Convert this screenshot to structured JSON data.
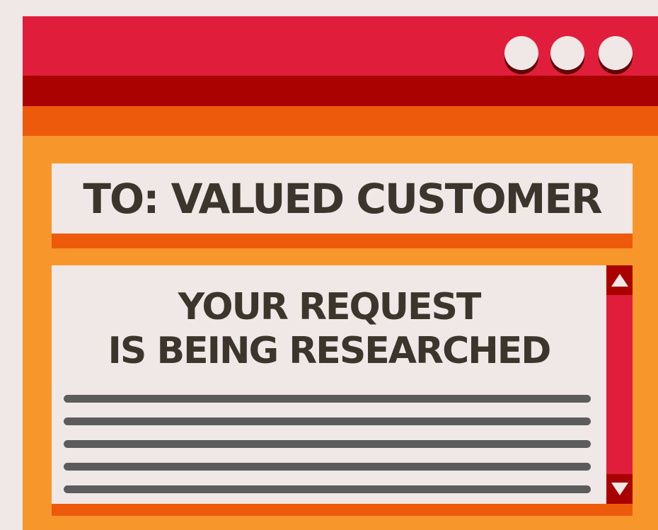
{
  "window": {
    "controls": [
      "dot",
      "dot",
      "dot"
    ]
  },
  "message": {
    "to_line": "TO: VALUED CUSTOMER",
    "title_line1": "YOUR REQUEST",
    "title_line2": "IS BEING RESEARCHED",
    "body_line_count": 5
  },
  "icons": {
    "scroll_up": "triangle-up-icon",
    "scroll_down": "triangle-down-icon"
  },
  "colors": {
    "title_bar": "#e01e3c",
    "title_bar_dark": "#a90201",
    "accent_orange": "#ee5a0c",
    "window_body": "#f7972b",
    "paper": "#efe8e6",
    "text": "#3d352c",
    "text_lines": "#5c5c5c"
  }
}
